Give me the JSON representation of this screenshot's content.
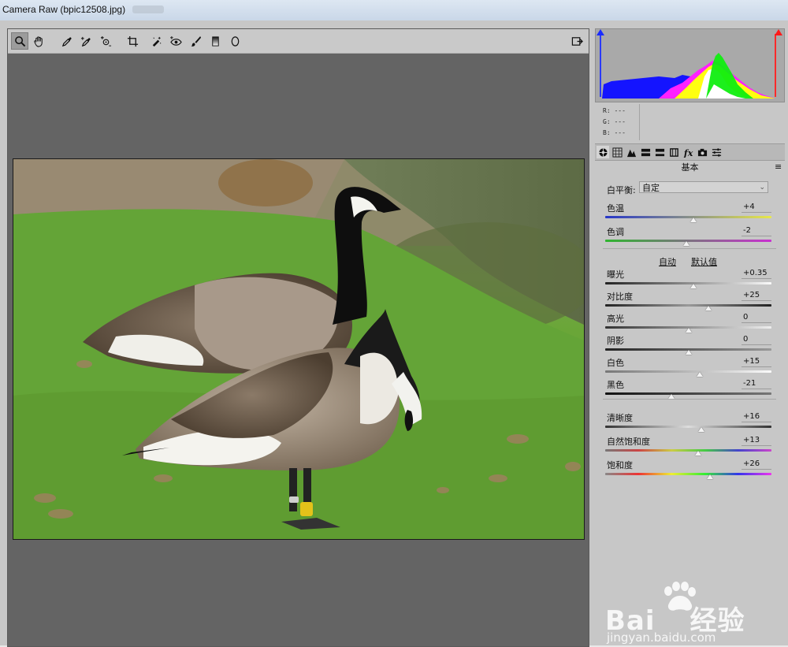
{
  "window": {
    "title": "Camera Raw (bpic12508.jpg)"
  },
  "toolbar": {
    "tools": [
      {
        "name": "zoom-tool",
        "icon": "magnifier-icon",
        "active": true
      },
      {
        "name": "hand-tool",
        "icon": "hand-icon",
        "active": false
      },
      {
        "name": "white-balance-tool",
        "icon": "eyedropper-icon",
        "active": false
      },
      {
        "name": "color-sampler-tool",
        "icon": "eyedropper-plus-icon",
        "active": false
      },
      {
        "name": "targeted-adjustment-tool",
        "icon": "target-icon",
        "active": false
      },
      {
        "name": "crop-tool",
        "icon": "crop-icon",
        "active": false
      },
      {
        "name": "spot-removal-tool",
        "icon": "brush-spot-icon",
        "active": false
      },
      {
        "name": "red-eye-tool",
        "icon": "eye-icon",
        "active": false
      },
      {
        "name": "adjustment-brush-tool",
        "icon": "brush-icon",
        "active": false
      },
      {
        "name": "graduated-filter-tool",
        "icon": "gradient-icon",
        "active": false
      },
      {
        "name": "radial-filter-tool",
        "icon": "ellipse-icon",
        "active": false
      }
    ],
    "fullscreen_icon": "toggle-fullscreen-icon"
  },
  "histogram": {
    "clip_shadow_color": "#1a2bff",
    "clip_highlight_color": "#ff1a1a"
  },
  "rgb_readout": {
    "r": "R:  ---",
    "g": "G:  ---",
    "b": "B:  ---"
  },
  "panel_tabs": [
    "basic-icon",
    "tone-curve-icon",
    "detail-icon",
    "hsl-icon",
    "split-toning-icon",
    "lens-icon",
    "effects-icon",
    "camera-calibration-icon",
    "presets-icon"
  ],
  "panel": {
    "title": "基本",
    "white_balance_label": "白平衡:",
    "white_balance_value": "自定",
    "auto_label": "自动",
    "default_label": "默认值"
  },
  "sliders": {
    "temperature": {
      "label": "色温",
      "value": "+4",
      "fraction": 0.53
    },
    "tint": {
      "label": "色调",
      "value": "-2",
      "fraction": 0.49
    },
    "exposure": {
      "label": "曝光",
      "value": "+0.35",
      "fraction": 0.53
    },
    "contrast": {
      "label": "对比度",
      "value": "+25",
      "fraction": 0.62
    },
    "highlights": {
      "label": "高光",
      "value": "0",
      "fraction": 0.5
    },
    "shadows": {
      "label": "阴影",
      "value": "0",
      "fraction": 0.5
    },
    "whites": {
      "label": "白色",
      "value": "+15",
      "fraction": 0.57
    },
    "blacks": {
      "label": "黑色",
      "value": "-21",
      "fraction": 0.4
    },
    "clarity": {
      "label": "清晰度",
      "value": "+16",
      "fraction": 0.58
    },
    "vibrance": {
      "label": "自然饱和度",
      "value": "+13",
      "fraction": 0.56
    },
    "saturation": {
      "label": "饱和度",
      "value": "+26",
      "fraction": 0.63
    }
  },
  "watermark": {
    "brand": "Bai",
    "brand_cn": "经验",
    "url": "jingyan.baidu.com"
  }
}
